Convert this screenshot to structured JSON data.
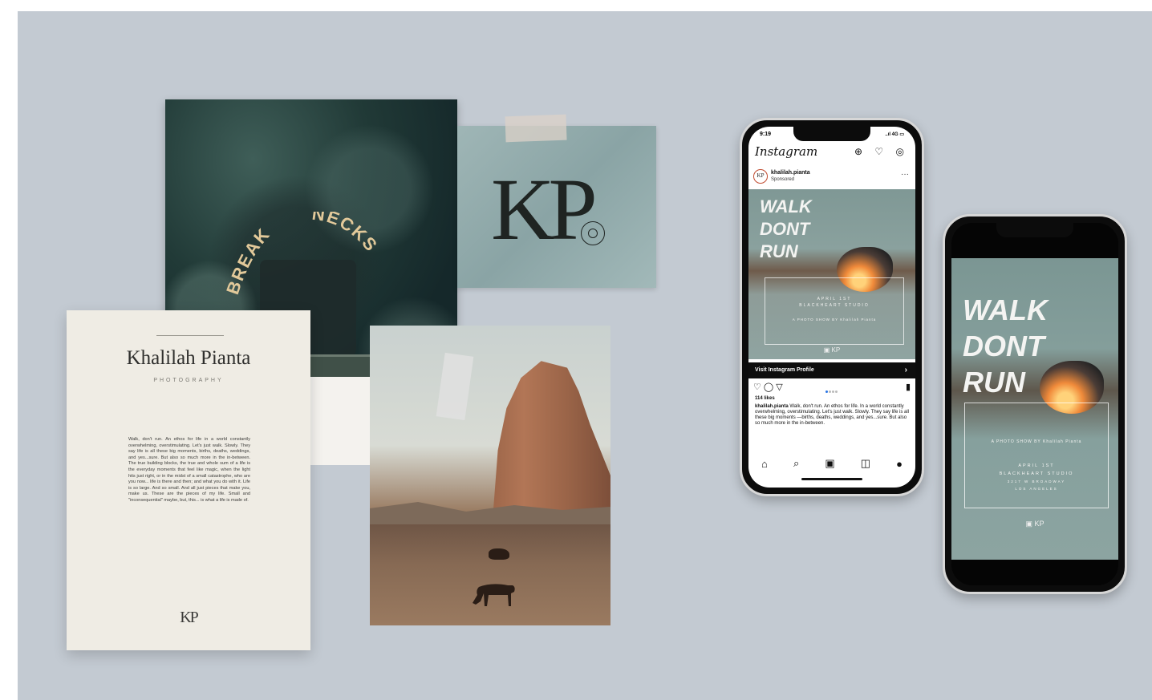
{
  "photo_badge": {
    "word1": "BREAK",
    "word2": "NECKS"
  },
  "logo": {
    "monogram": "KP"
  },
  "card": {
    "name": "Khalilah Pianta",
    "subtitle": "PHOTOGRAPHY",
    "body": "Walk, don't run. An ethos for life in a world constantly overwhelming, overstimulating. Let's just walk. Slowly. They say life is all these big moments, births, deaths, weddings, and yes...sure. But also so much more in the in-between. The true building blocks, the true and whole sum of a life is the everyday moments that feel like magic, when the light hits just right, or in the midst of a small catastrophe, who are you now... life is there and then; and what you do with it. Life is so large. And so small. And all just pieces that make you, make us. These are the pieces of my life. Small and \"inconsequential\" maybe, but, this... is what a life is made of.",
    "monogram": "KP"
  },
  "phone1": {
    "time": "9:19",
    "signal": "..ıl 4G ▭",
    "app_name": "Instagram",
    "header_icons": "⊕ ♡ ◎",
    "avatar": "KP",
    "username": "khalilah.pianta",
    "sponsored": "Sponsored",
    "more": "···",
    "ad_title_lines": [
      "WALK",
      "DONT",
      "RUN"
    ],
    "ad_event": [
      "APRIL 1ST",
      "BLACKHEART STUDIO"
    ],
    "ad_credit": "A PHOTO SHOW BY Khalilah Pianta",
    "ad_footer": "▣ KP",
    "visit_label": "Visit Instagram Profile",
    "visit_arrow": "›",
    "actions": "♡ ◯ ▽",
    "bookmark": "▮",
    "likes": "114 likes",
    "caption_user": "khalilah.pianta",
    "caption_text": " Walk, don't run. An ethos for life. In a world constantly overwhelming, overstimulating. Let's just walk. Slowly. They say life is all these big moments —births, deaths, weddings, and yes...sure. But also so much more in the in-between.",
    "nav": [
      "⌂",
      "⌕",
      "▣",
      "◫",
      "●"
    ]
  },
  "phone2": {
    "story_title_lines": [
      "WALK",
      "DONT",
      "RUN"
    ],
    "story_credit": "A PHOTO SHOW BY Khalilah Pianta",
    "story_event": [
      "APRIL 1ST",
      "BLACKHEART STUDIO",
      "3217 W BROADWAY",
      "LOS ANGELES"
    ],
    "story_footer": "▣ KP"
  }
}
